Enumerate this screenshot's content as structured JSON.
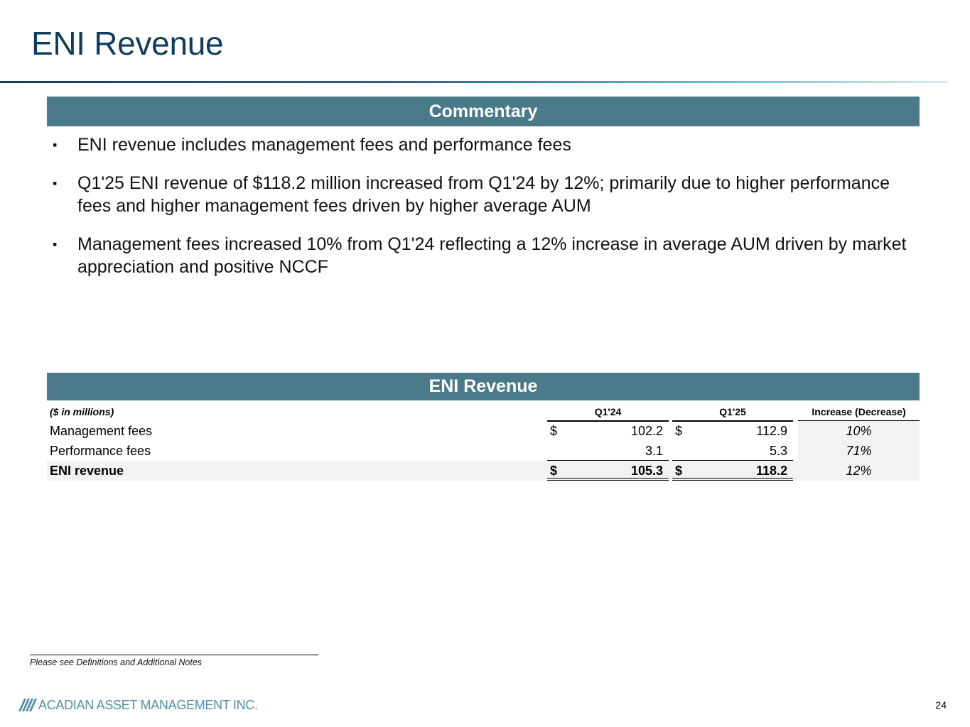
{
  "page": {
    "title": "ENI Revenue",
    "number": "24"
  },
  "commentary": {
    "header": "Commentary",
    "bullet_glyph": "▪",
    "bullets": [
      "ENI revenue includes management fees and performance fees",
      "Q1'25 ENI revenue of $118.2 million increased from Q1'24 by 12%; primarily due to higher performance fees and higher management fees driven by higher average AUM",
      "Management fees increased 10% from Q1'24 reflecting a 12% increase in average AUM driven by market appreciation and positive NCCF"
    ]
  },
  "table": {
    "header": "ENI Revenue",
    "units": "($ in millions)",
    "columns": [
      "Q1'24",
      "Q1'25",
      "Increase (Decrease)"
    ],
    "rows": [
      {
        "label": "Management fees",
        "q124_dollar": "$",
        "q124": "102.2",
        "q125_dollar": "$",
        "q125": "112.9",
        "change": "10%"
      },
      {
        "label": "Performance fees",
        "q124_dollar": "",
        "q124": "3.1",
        "q125_dollar": "",
        "q125": "5.3",
        "change": "71%"
      },
      {
        "label": "ENI revenue",
        "q124_dollar": "$",
        "q124": "105.3",
        "q125_dollar": "$",
        "q125": "118.2",
        "change": "12%"
      }
    ]
  },
  "footnote": "Please see Definitions and Additional Notes",
  "logo": {
    "text": "ACADIAN ASSET MANAGEMENT INC.",
    "color": "#4d8eab"
  },
  "colors": {
    "title": "#0f3d5c",
    "section_header": "#4a7a89",
    "shade": "#f2f2f2"
  }
}
